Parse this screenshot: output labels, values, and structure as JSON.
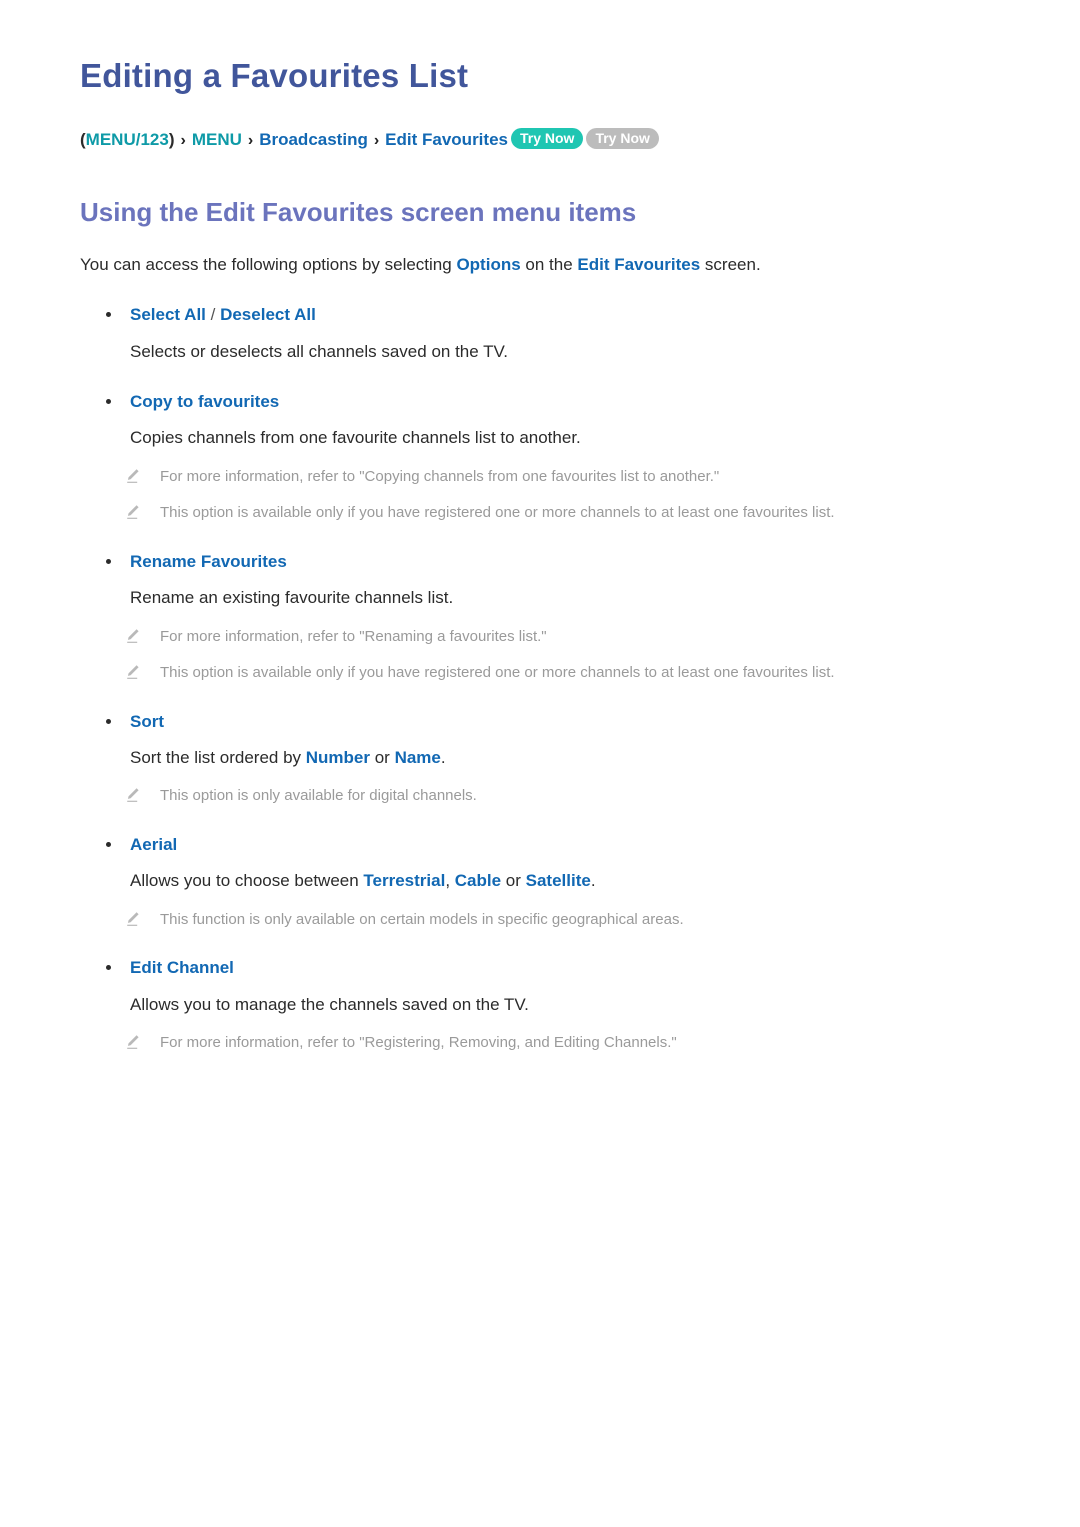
{
  "document": {
    "title": "Editing a Favourites List"
  },
  "breadcrumb": {
    "open_paren": "(",
    "menu123": "MENU/123",
    "close_paren": ")",
    "separator": "›",
    "menu": "MENU",
    "broadcasting": "Broadcasting",
    "edit_favourites": "Edit Favourites",
    "badge_primary": "Try Now",
    "badge_secondary": "Try Now",
    "colors": {
      "teal": "#0e9aa7",
      "blue": "#1268b3",
      "badge_teal": "#1fc6b2",
      "badge_grey": "#bcbcbc"
    }
  },
  "section": {
    "heading": "Using the Edit Favourites screen menu items",
    "intro": {
      "part1": "You can access the following options by selecting ",
      "kw1": "Options",
      "part2": " on the ",
      "kw2": "Edit Favourites",
      "part3": " screen."
    }
  },
  "options": [
    {
      "title_a": "Select All",
      "slash": " / ",
      "title_b": "Deselect All",
      "desc": "Selects or deselects all channels saved on the TV.",
      "notes": []
    },
    {
      "title_a": "Copy to favourites",
      "desc": "Copies channels from one favourite channels list to another.",
      "notes": [
        "For more information, refer to \"Copying channels from one favourites list to another.\"",
        "This option is available only if you have registered one or more channels to at least one favourites list."
      ]
    },
    {
      "title_a": "Rename Favourites",
      "desc": "Rename an existing favourite channels list.",
      "notes": [
        "For more information, refer to \"Renaming a favourites list.\"",
        "This option is available only if you have registered one or more channels to at least one favourites list."
      ]
    },
    {
      "title_a": "Sort",
      "desc_part1": "Sort the list ordered by ",
      "desc_kw1": "Number",
      "desc_part2": " or ",
      "desc_kw2": "Name",
      "desc_part3": ".",
      "notes": [
        "This option is only available for digital channels."
      ]
    },
    {
      "title_a": "Aerial",
      "desc_part1": "Allows you to choose between ",
      "desc_kw1": "Terrestrial",
      "desc_part2": ", ",
      "desc_kw2": "Cable",
      "desc_part3": " or ",
      "desc_kw3": "Satellite",
      "desc_part4": ".",
      "notes": [
        "This function is only available on certain models in specific geographical areas."
      ]
    },
    {
      "title_a": "Edit Channel",
      "desc": "Allows you to manage the channels saved on the TV.",
      "notes": [
        "For more information, refer to \"Registering, Removing, and Editing Channels.\""
      ]
    }
  ],
  "icons": {
    "note": "pencil-icon"
  }
}
